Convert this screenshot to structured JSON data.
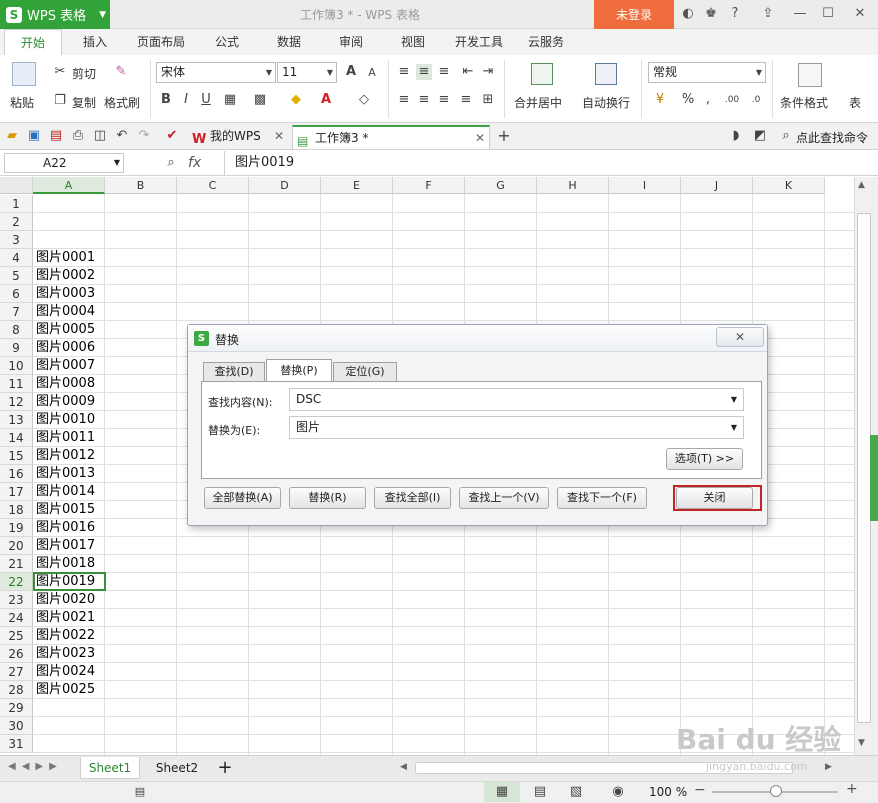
{
  "app": {
    "name": "WPS 表格",
    "doc_title": "工作簿3 * - WPS 表格",
    "login": "未登录"
  },
  "ribbon_tabs": [
    "开始",
    "插入",
    "页面布局",
    "公式",
    "数据",
    "审阅",
    "视图",
    "开发工具",
    "云服务"
  ],
  "ribbon": {
    "paste": "粘贴",
    "cut": "剪切",
    "copy": "复制",
    "format_painter": "格式刷",
    "font_name": "宋体",
    "font_size": "11",
    "merge_center": "合并居中",
    "wrap_text": "自动换行",
    "number_format": "常规",
    "cond_format": "条件格式",
    "table_more": "表"
  },
  "doc_tabs": [
    {
      "label": "我的WPS"
    },
    {
      "label": "工作簿3 *"
    }
  ],
  "search_cmd": "点此查找命令",
  "formula_bar": {
    "name_box": "A22",
    "fx": "fx",
    "value": "图片0019"
  },
  "columns": [
    "A",
    "B",
    "C",
    "D",
    "E",
    "F",
    "G",
    "H",
    "I",
    "J",
    "K"
  ],
  "rows": [
    "1",
    "2",
    "3",
    "4",
    "5",
    "6",
    "7",
    "8",
    "9",
    "10",
    "11",
    "12",
    "13",
    "14",
    "15",
    "16",
    "17",
    "18",
    "19",
    "20",
    "21",
    "22",
    "23",
    "24",
    "25",
    "26",
    "27",
    "28",
    "29",
    "30",
    "31"
  ],
  "column_a_values": [
    "",
    "",
    "",
    "图片0001",
    "图片0002",
    "图片0003",
    "图片0004",
    "图片0005",
    "图片0006",
    "图片0007",
    "图片0008",
    "图片0009",
    "图片0010",
    "图片0011",
    "图片0012",
    "图片0013",
    "图片0014",
    "图片0015",
    "图片0016",
    "图片0017",
    "图片0018",
    "图片0019",
    "图片0020",
    "图片0021",
    "图片0022",
    "图片0023",
    "图片0024",
    "图片0025",
    "",
    "",
    ""
  ],
  "selected": {
    "row": 22,
    "col": "A"
  },
  "dialog": {
    "title": "替换",
    "close_glyph": "✕",
    "tabs": [
      "查找(D)",
      "替换(P)",
      "定位(G)"
    ],
    "active_tab": "替换(P)",
    "find_label": "查找内容(N):",
    "find_value": "DSC",
    "replace_label": "替换为(E):",
    "replace_value": "图片",
    "options_btn": "选项(T) >>",
    "buttons": {
      "replace_all": "全部替换(A)",
      "replace": "替换(R)",
      "find_all": "查找全部(I)",
      "find_prev": "查找上一个(V)",
      "find_next": "查找下一个(F)",
      "close": "关闭"
    }
  },
  "sheets": [
    "Sheet1",
    "Sheet2"
  ],
  "status": {
    "zoom": "100 %"
  },
  "watermark": {
    "main": "Bai du 经验",
    "sub": "jingyan.baidu.com"
  },
  "colors": {
    "green": "#31a338",
    "login_orange": "#ef6c3c",
    "highlight_red": "#c12525"
  }
}
